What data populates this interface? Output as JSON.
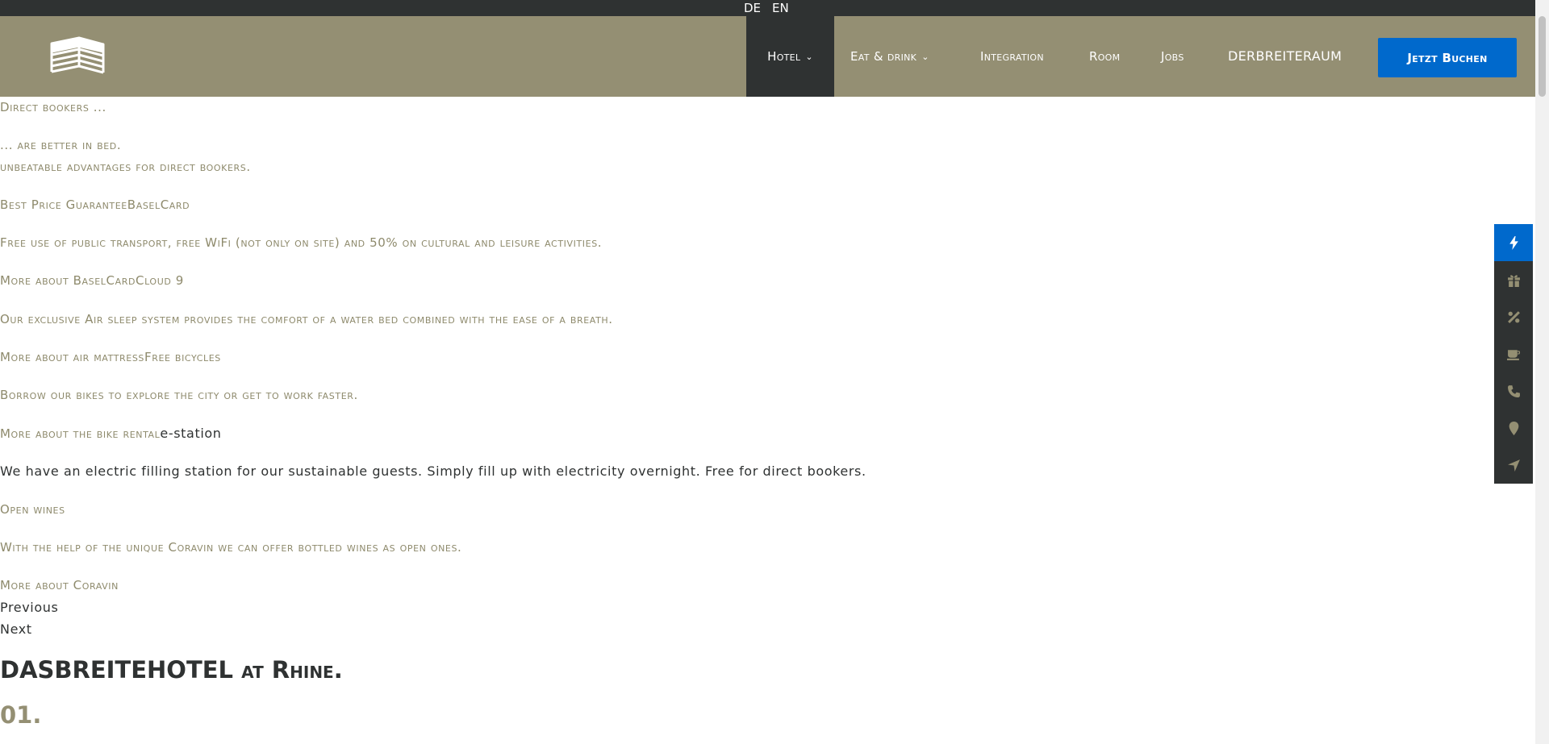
{
  "topbar": {
    "lang_de": "DE",
    "lang_en": "EN"
  },
  "header": {
    "logo_icon": "building-logo",
    "nav": {
      "hotel": "Hotel",
      "eat": "Eat & drink",
      "integration": "Integration",
      "room": "Room",
      "jobs": "Jobs",
      "raum": "DERBREITERAUM"
    },
    "chevron": "⌄",
    "book_label": "Jetzt Buchen"
  },
  "content": {
    "direct_bookers": "Direct bookers ...",
    "better_in_bed": "... are better in bed.",
    "unbeatable": "unbeatable advantages for direct bookers.",
    "slide_titles_1": "Best Price GuaranteeBaselCard",
    "basel_desc": "Free use of public transport, free WiFi (not only on site) and 50% on cultural and leisure activities.",
    "more_basel": "More about BaselCardCloud 9",
    "cloud_desc": "Our exclusive Air sleep system provides the comfort of a water bed combined with the ease of a breath.",
    "more_air": "More about air mattressFree bicycles",
    "bikes_desc": "Borrow our bikes to explore the city or get to work faster.",
    "more_bike": "More about the bike rental",
    "estation": "e-station",
    "estation_desc": "We have an electric filling station for our sustainable guests. Simply fill up with electricity overnight. Free for direct bookers.",
    "open_wines": "Open wines",
    "wines_desc": "With the help of the unique Coravin we can offer bottled wines as open ones.",
    "more_coravin": "More about Coravin",
    "previous": "Previous",
    "next": "Next",
    "title_main": "DASBREITEHOTEL",
    "title_rest": "at Rhine.",
    "section_number": "01."
  },
  "sidebar": {
    "icons": [
      "lightning-icon",
      "gift-icon",
      "percent-icon",
      "coffee-icon",
      "phone-icon",
      "map-marker-icon",
      "location-arrow-icon"
    ]
  },
  "colors": {
    "olive": "#948f73",
    "dark": "#2f3232",
    "accent_blue": "#0069cc"
  }
}
